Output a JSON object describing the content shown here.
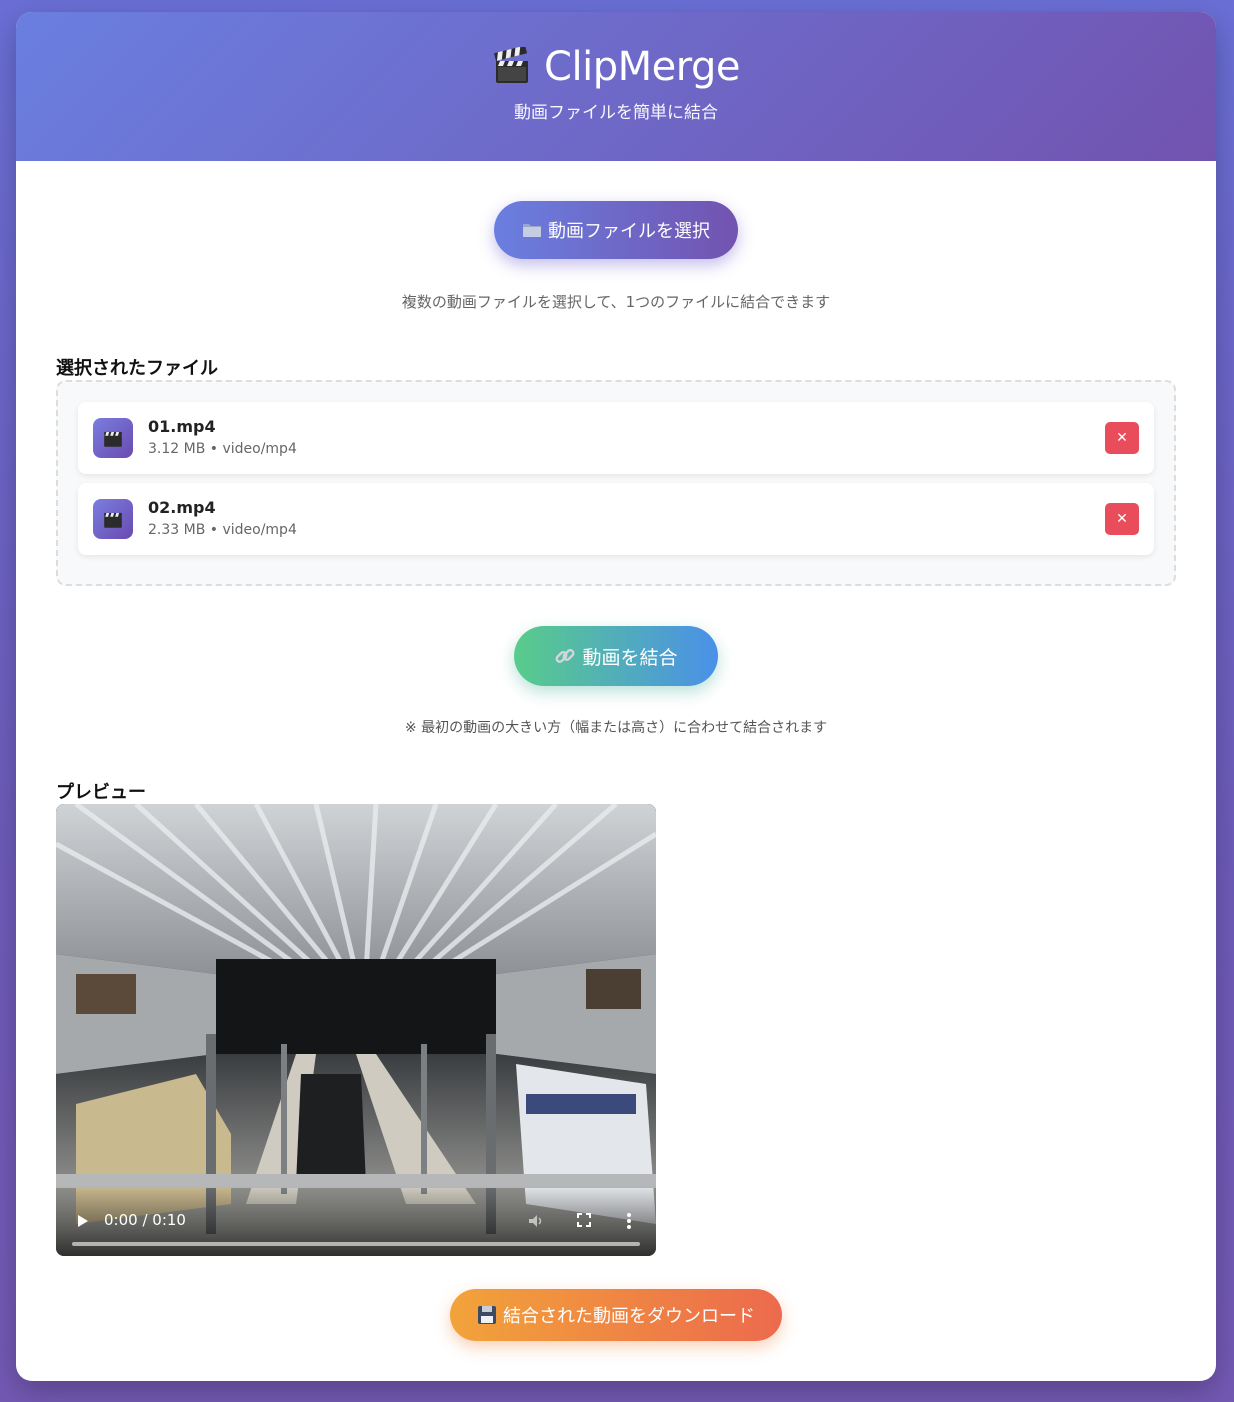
{
  "header": {
    "app_name": "ClipMerge",
    "app_icon": "clapperboard-icon",
    "subtitle": "動画ファイルを簡単に結合"
  },
  "select": {
    "button_label": "動画ファイルを選択",
    "button_icon": "folder-icon",
    "helper": "複数の動画ファイルを選択して、1つのファイルに結合できます"
  },
  "files": {
    "title": "選択されたファイル",
    "items": [
      {
        "name": "01.mp4",
        "meta": "3.12 MB • video/mp4",
        "remove_label": "✕"
      },
      {
        "name": "02.mp4",
        "meta": "2.33 MB • video/mp4",
        "remove_label": "✕"
      }
    ]
  },
  "merge": {
    "button_label": "動画を結合",
    "button_icon": "link-icon",
    "note": "※ 最初の動画の大きい方（幅または高さ）に合わせて結合されます"
  },
  "preview": {
    "title": "プレビュー",
    "time": "0:00 / 0:10",
    "progress": 0
  },
  "download": {
    "button_label": "結合された動画をダウンロード",
    "button_icon": "floppy-disk-icon"
  },
  "colors": {
    "header_start": "#6a7fe0",
    "header_end": "#7253b0",
    "remove": "#e94c5b",
    "merge_start": "#59cc8a",
    "merge_end": "#4a90e8",
    "download_start": "#f2a33a",
    "download_end": "#ec6a4d"
  }
}
